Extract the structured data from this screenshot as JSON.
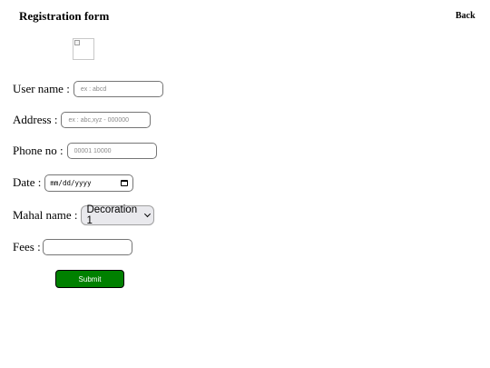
{
  "header": {
    "title": "Registration form",
    "back_label": "Back"
  },
  "form": {
    "username": {
      "label": "User name :",
      "placeholder": "ex : abcd",
      "value": ""
    },
    "address": {
      "label": "Address :",
      "placeholder": "ex : abc,xyz - 000000",
      "value": ""
    },
    "phone": {
      "label": "Phone no :",
      "placeholder": "00001 10000",
      "value": ""
    },
    "date": {
      "label": "Date :",
      "display": "mm/dd/yyyy",
      "value": ""
    },
    "mahal": {
      "label": "Mahal name :",
      "selected": "Decoration 1"
    },
    "fees": {
      "label": "Fees :",
      "value": ""
    },
    "submit_label": "Submit"
  },
  "icons": {
    "header_image": "broken-image-icon",
    "date_picker": "calendar-icon",
    "select_arrow": "chevron-down-icon"
  },
  "colors": {
    "submit_background": "#008000",
    "submit_text": "#ffffff"
  }
}
